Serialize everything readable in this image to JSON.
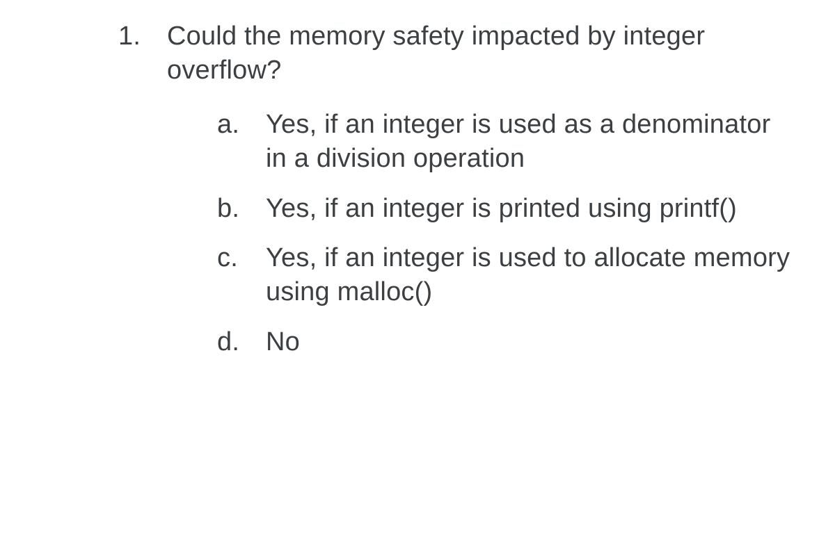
{
  "question": {
    "number": "1.",
    "text": "Could the memory safety impacted by integer overflow?"
  },
  "options": [
    {
      "label": "a.",
      "text": "Yes, if an integer is used as a denominator in a division operation"
    },
    {
      "label": "b.",
      "text": "Yes, if an integer is printed using printf()"
    },
    {
      "label": "c.",
      "text": "Yes, if an integer is used to allocate memory using malloc()"
    },
    {
      "label": "d.",
      "text": "No"
    }
  ]
}
